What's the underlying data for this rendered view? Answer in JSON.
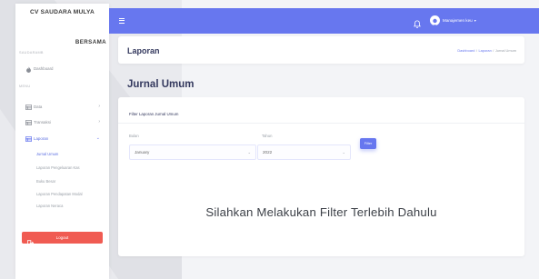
{
  "colors": {
    "primary": "#6777ef",
    "logout": "#f05b52",
    "background": "#f3f4f7"
  },
  "sidebar": {
    "brand_title": "CV SAUDARA MULYA",
    "brand_sub": "BERSAMA",
    "brand_small": "SAUDARAMB",
    "menu_label": "MENU",
    "items": [
      {
        "label": "Dashboard",
        "icon": "fire-icon"
      },
      {
        "label": "Data",
        "icon": "table-icon",
        "has_chevron": true
      },
      {
        "label": "Transaksi",
        "icon": "table-icon",
        "has_chevron": true
      },
      {
        "label": "Laporan",
        "icon": "table-icon",
        "has_chevron": true,
        "expanded": true,
        "active": true
      }
    ],
    "sub_items": [
      {
        "label": "Jurnal Umum",
        "active": true
      },
      {
        "label": "Laporan Pengeluaran Kas"
      },
      {
        "label": "Buku Besar"
      },
      {
        "label": "Laporan Pendapatan Modal"
      },
      {
        "label": "Laporan Neraca"
      }
    ],
    "logout_label": "Logout"
  },
  "topbar": {
    "user_name": "Manajemen keu",
    "icons": [
      "bars-icon",
      "bell-icon",
      "user-avatar-icon",
      "caret-down-icon"
    ]
  },
  "header": {
    "title": "Laporan",
    "breadcrumb": [
      "Dashboard",
      "Laporan",
      "Jurnal Umum"
    ]
  },
  "main": {
    "title": "Jurnal Umum",
    "filter_label": "Filter Laporan Jurnal Umum",
    "bulan_label": "Bulan",
    "bulan_value": "January",
    "tahun_label": "Tahun",
    "tahun_value": "2022",
    "filter_button": "Filter",
    "empty_message": "Silahkan Melakukan Filter Terlebih Dahulu"
  }
}
